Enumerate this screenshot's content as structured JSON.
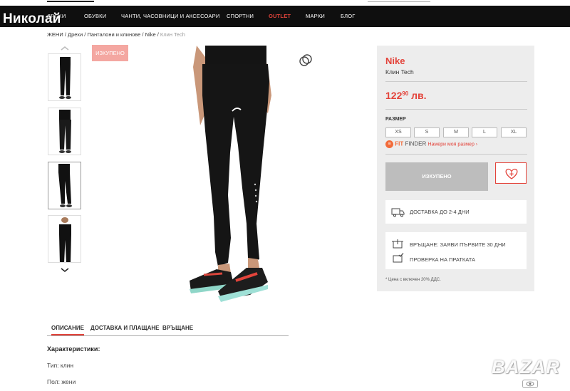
{
  "watermark_name": "Николай",
  "nav": {
    "items": [
      "ДРЕХИ",
      "ОБУВКИ",
      "ЧАНТИ, ЧАСОВНИЦИ И АКСЕСОАРИ",
      "СПОРТНИ",
      "OUTLET",
      "МАРКИ",
      "БЛОГ"
    ]
  },
  "breadcrumb": {
    "items": [
      "ЖЕНИ",
      "Дрехи",
      "Панталони и клинове",
      "Nike"
    ],
    "separator": " / ",
    "current": "Клин Tech"
  },
  "badge": "ИЗКУПЕНО",
  "product": {
    "brand": "Nike",
    "name": "Клин Tech",
    "price_main": "122",
    "price_cents": "90",
    "currency": "лв.",
    "size_label": "РАЗМЕР",
    "sizes": [
      "XS",
      "S",
      "M",
      "L",
      "XL"
    ],
    "fitfinder_fit": "FIT",
    "fitfinder_finder": "FINDER",
    "fitfinder_link": "Намери моя размер ›",
    "soldout_button": "ИЗКУПЕНО",
    "delivery": "ДОСТАВКА ДО 2-4 ДНИ",
    "return_text": "ВРЪЩАНЕ: ЗАЯВИ ПЪРВИТЕ 30 ДНИ",
    "check_text": "ПРОВЕРКА НА ПРАТКАТА",
    "vat_note": "* Цена с включен 20% ДДС."
  },
  "tabs": [
    "ОПИСАНИЕ",
    "ДОСТАВКА И ПЛАЩАНЕ",
    "ВРЪЩАНЕ"
  ],
  "description": {
    "title": "Характеристики:",
    "lines": [
      "Тип: клин",
      "Пол: жени"
    ]
  },
  "colors": {
    "accent": "#e3443b",
    "nav_bg": "#0f0f0f",
    "panel_bg": "#ededed",
    "badge_bg": "#f4a7a1"
  },
  "icons": [
    "gallery-zoom-icon",
    "chevron-up-icon",
    "chevron-down-icon",
    "heart-plus-icon",
    "truck-icon",
    "return-box-icon",
    "check-box-icon",
    "fitfinder-icon",
    "eye-icon"
  ],
  "bazar_watermark": "BAZAR"
}
